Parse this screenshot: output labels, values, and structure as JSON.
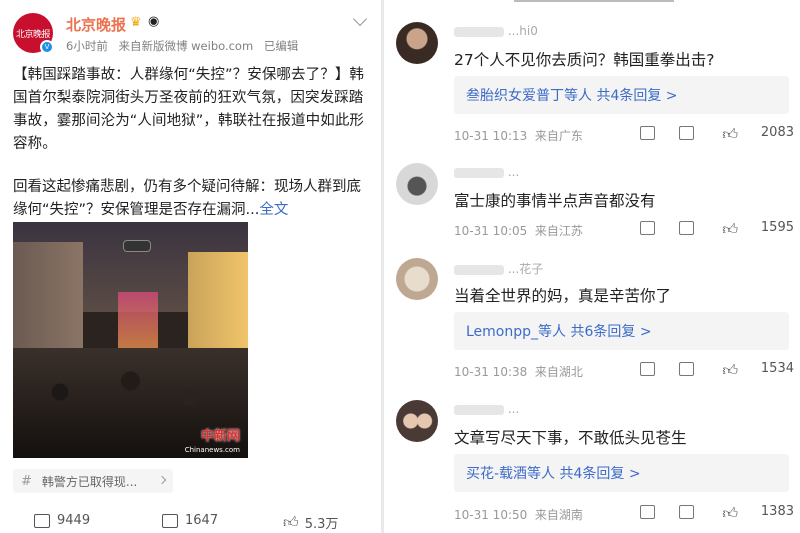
{
  "post": {
    "author": "北京晚报",
    "avatar_text": "北京晚报",
    "time": "6小时前",
    "source": "来自新版微博 weibo.com",
    "edited": "已编辑",
    "text": "【韩国踩踏事故：人群缘何“失控”？安保哪去了？】韩国首尔梨泰院洞街头万圣夜前的狂欢气氛，因突发踩踏事故，霎那间沦为“人间地狱”，韩联社在报道中如此形容称。",
    "text2": "回看这起惨痛悲剧，仍有多个疑问待解：现场人群到底缘何“失控”？安保管理是否存在漏洞...",
    "full_text_link": "全文",
    "photo_watermark": "中新网",
    "photo_watermark_sub": "Chinanews.com",
    "topic": "韩警方已取得现...",
    "repost_count": "9449",
    "comment_count": "1647",
    "like_count": "5.3万"
  },
  "comments": [
    {
      "name": "...hi0",
      "text": "27个人不见你去质问？韩国重拳出击?",
      "reply_summary": "叁胎织女爱普丁等人  共4条回复 >",
      "time": "10-31 10:13",
      "location": "来自广东",
      "likes": "2083"
    },
    {
      "name": "...",
      "text": "富士康的事情半点声音都没有",
      "reply_summary": "",
      "time": "10-31 10:05",
      "location": "来自江苏",
      "likes": "1595"
    },
    {
      "name": "...花子",
      "text": "当着全世界的妈，真是辛苦你了",
      "reply_summary": "Lemonpp_等人  共6条回复 >",
      "time": "10-31 10:38",
      "location": "来自湖北",
      "likes": "1534"
    },
    {
      "name": "...",
      "text": "文章写尽天下事，不敢低头见苍生",
      "reply_summary": "买花-载酒等人  共4条回复 >",
      "time": "10-31 10:50",
      "location": "来自湖南",
      "likes": "1383"
    }
  ],
  "colors": {
    "author": "#eb7350",
    "link": "#3c6bc8",
    "brand_red": "#c8102e"
  }
}
